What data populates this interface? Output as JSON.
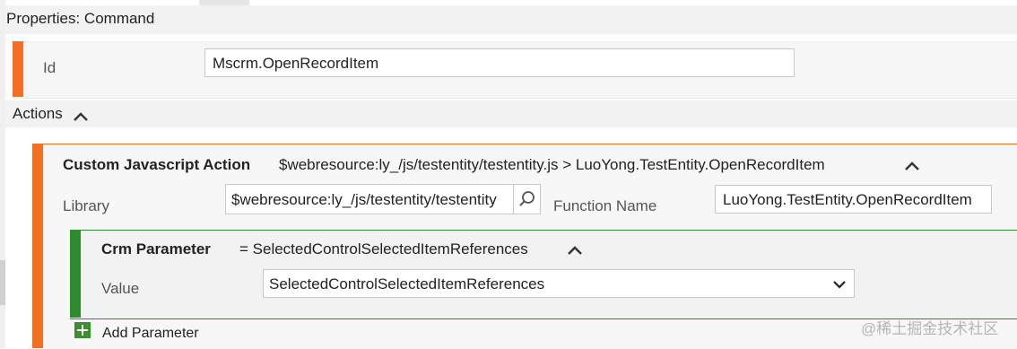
{
  "panel": {
    "title": "Properties: Command"
  },
  "id_field": {
    "label": "Id",
    "value": "Mscrm.OpenRecordItem"
  },
  "actions": {
    "label": "Actions"
  },
  "custom_js_action": {
    "title": "Custom Javascript Action",
    "summary": "$webresource:ly_/js/testentity/testentity.js > LuoYong.TestEntity.OpenRecordItem",
    "library_label": "Library",
    "library_value": "$webresource:ly_/js/testentity/testentity",
    "function_label": "Function Name",
    "function_value": "LuoYong.TestEntity.OpenRecordItem"
  },
  "crm_parameter": {
    "title": "Crm Parameter",
    "summary": "= SelectedControlSelectedItemReferences",
    "value_label": "Value",
    "value_selected": "SelectedControlSelectedItemReferences"
  },
  "add_parameter": {
    "label": "Add Parameter"
  },
  "watermark": "@稀土掘金技术社区",
  "colors": {
    "accent_orange": "#f36f23",
    "accent_green": "#2e8b2e"
  }
}
